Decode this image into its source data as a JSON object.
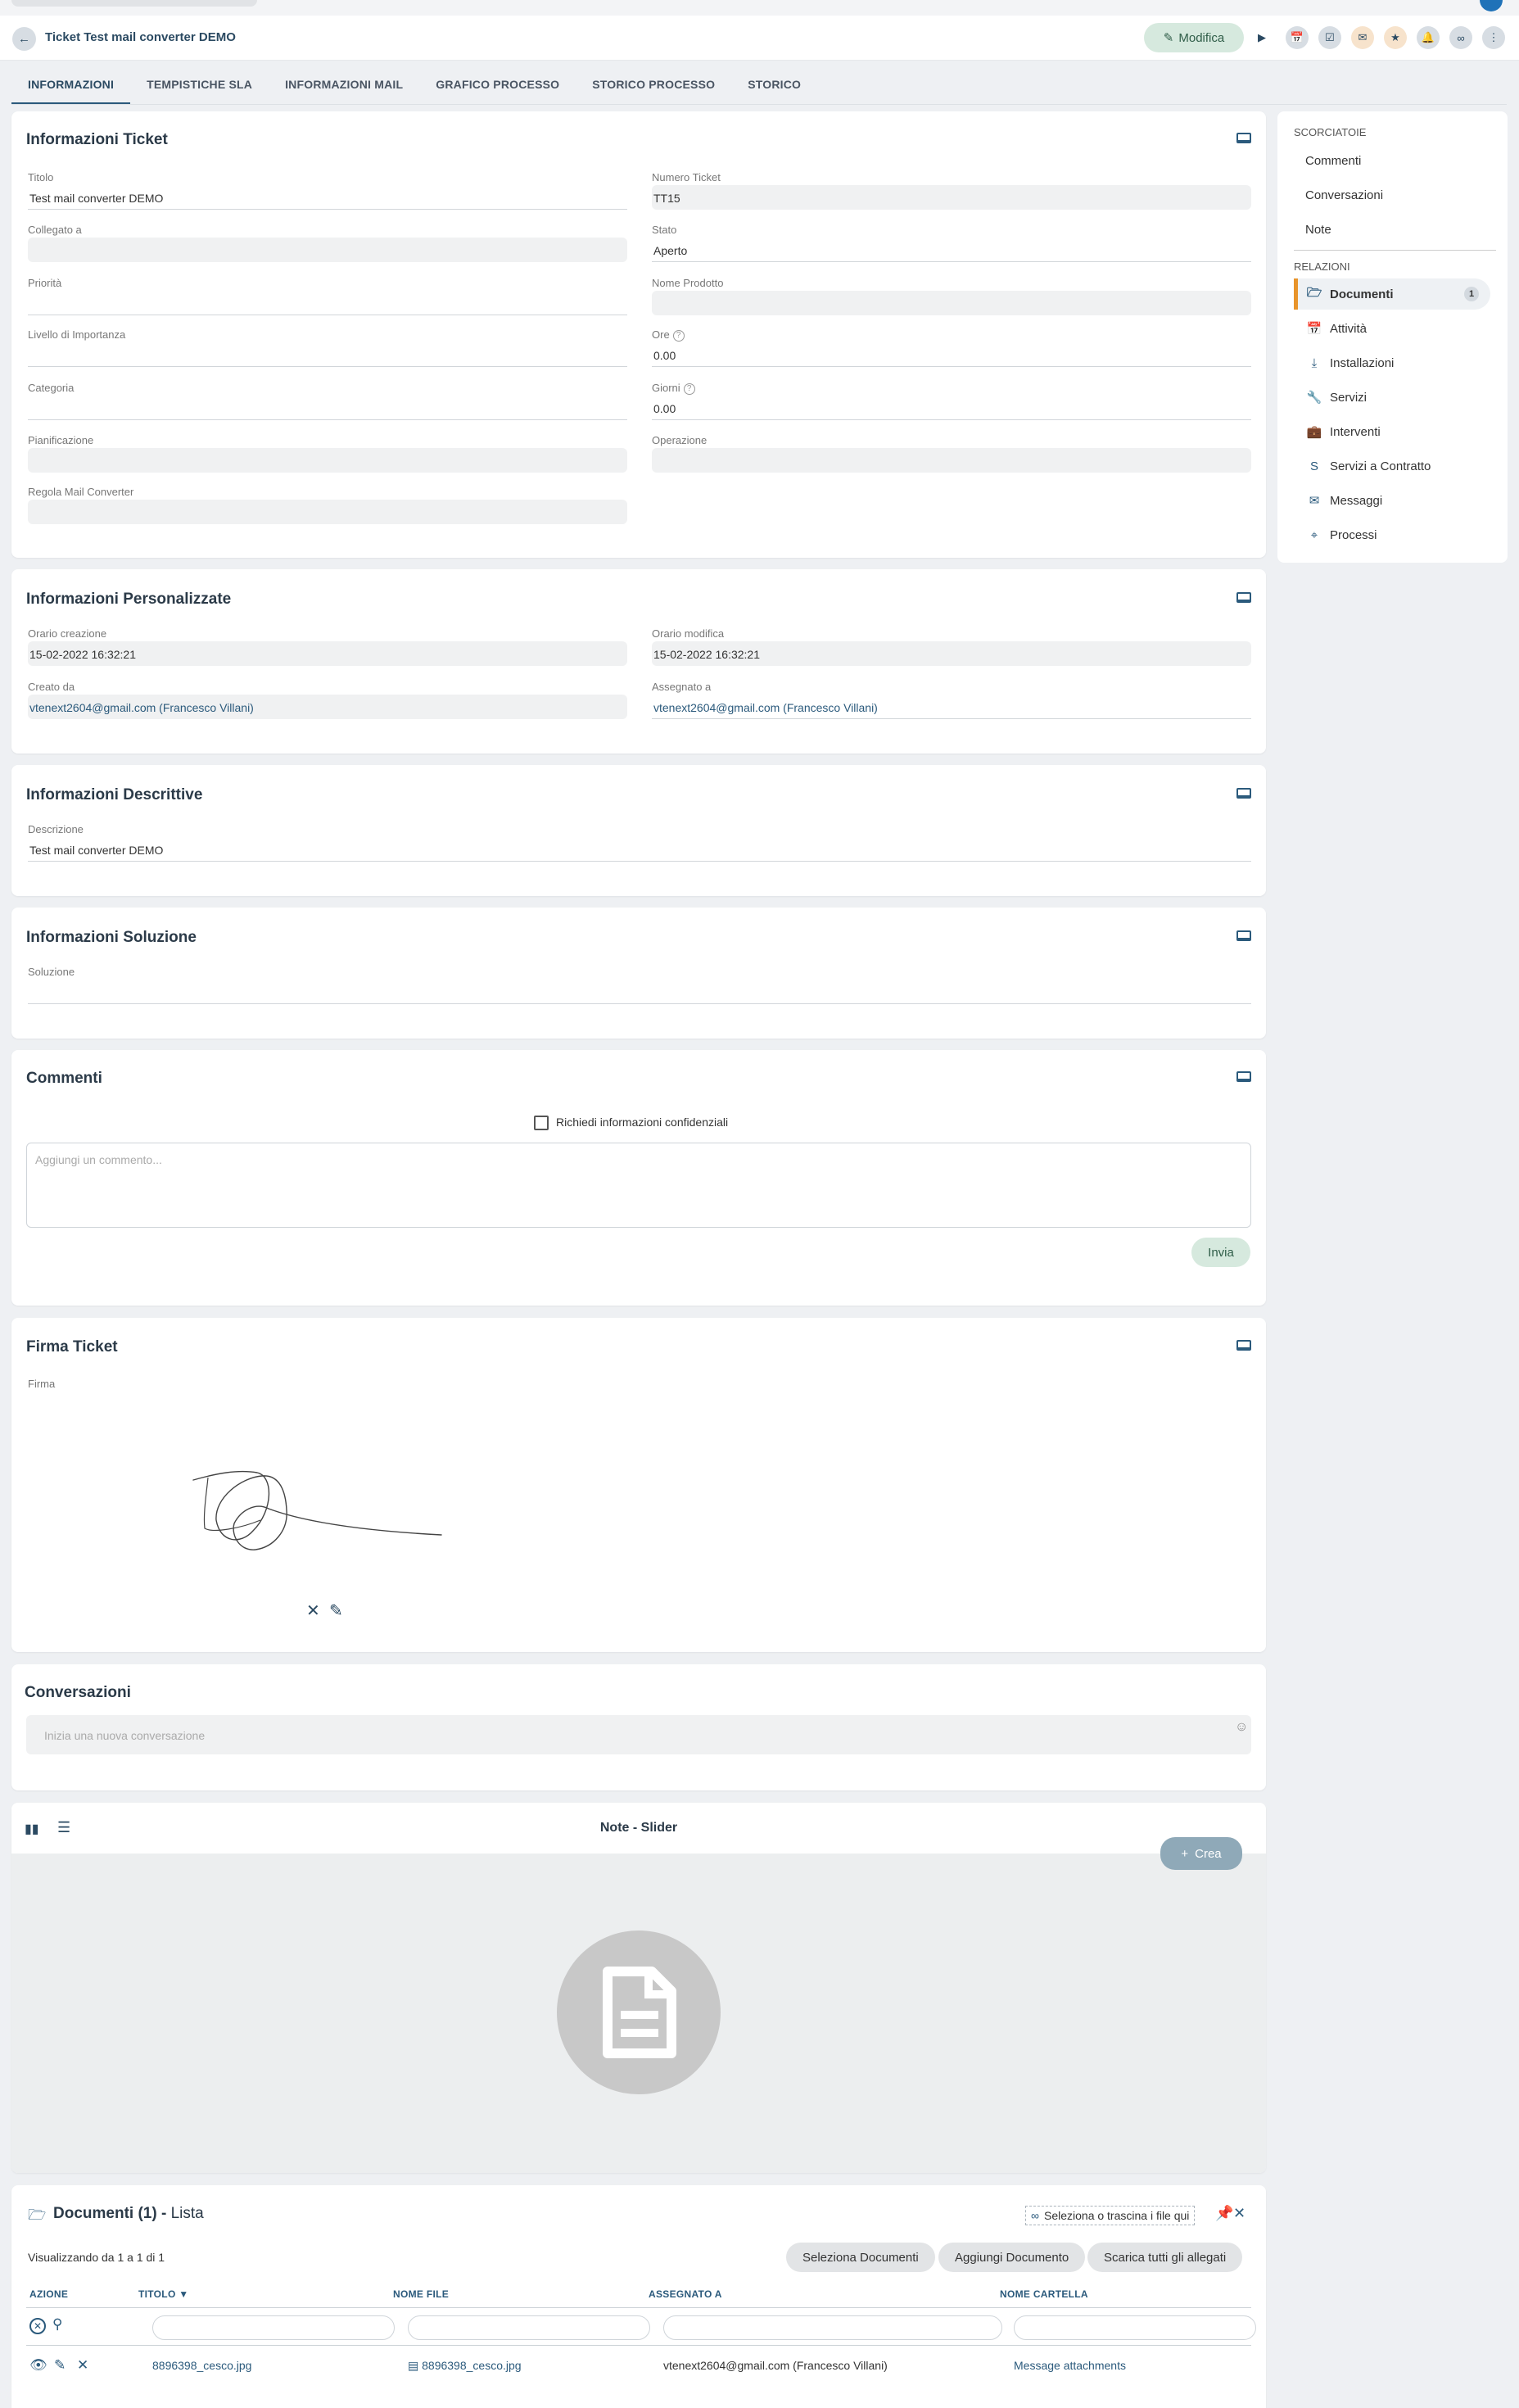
{
  "header": {
    "title": "Ticket Test mail converter DEMO",
    "edit_label": "Modifica"
  },
  "tabs": [
    {
      "label": "INFORMAZIONI"
    },
    {
      "label": "TEMPISTICHE SLA"
    },
    {
      "label": "INFORMAZIONI MAIL"
    },
    {
      "label": "GRAFICO PROCESSO"
    },
    {
      "label": "STORICO PROCESSO"
    },
    {
      "label": "STORICO"
    }
  ],
  "ticket_info": {
    "title": "Informazioni Ticket",
    "fields": {
      "titolo": {
        "label": "Titolo",
        "value": "Test mail converter DEMO"
      },
      "numero": {
        "label": "Numero Ticket",
        "value": "TT15"
      },
      "collegato": {
        "label": "Collegato a",
        "value": ""
      },
      "stato": {
        "label": "Stato",
        "value": "Aperto"
      },
      "priorita": {
        "label": "Priorità",
        "value": ""
      },
      "prodotto": {
        "label": "Nome Prodotto",
        "value": ""
      },
      "livello": {
        "label": "Livello di Importanza",
        "value": ""
      },
      "ore": {
        "label": "Ore",
        "value": "0.00"
      },
      "categoria": {
        "label": "Categoria",
        "value": ""
      },
      "giorni": {
        "label": "Giorni",
        "value": "0.00"
      },
      "pianificazione": {
        "label": "Pianificazione",
        "value": ""
      },
      "operazione": {
        "label": "Operazione",
        "value": ""
      },
      "regola": {
        "label": "Regola Mail Converter",
        "value": ""
      }
    }
  },
  "custom_info": {
    "title": "Informazioni Personalizzate",
    "fields": {
      "creazione": {
        "label": "Orario creazione",
        "value": "15-02-2022 16:32:21"
      },
      "modifica": {
        "label": "Orario modifica",
        "value": "15-02-2022 16:32:21"
      },
      "creato": {
        "label": "Creato da",
        "value": "vtenext2604@gmail.com (Francesco Villani)"
      },
      "assegnato": {
        "label": "Assegnato a",
        "value": "vtenext2604@gmail.com (Francesco Villani)"
      }
    }
  },
  "desc_info": {
    "title": "Informazioni Descrittive",
    "label": "Descrizione",
    "value": "Test mail converter DEMO"
  },
  "solution_info": {
    "title": "Informazioni Soluzione",
    "label": "Soluzione",
    "value": ""
  },
  "comments": {
    "title": "Commenti",
    "confidential_label": "Richiedi informazioni confidenziali",
    "placeholder": "Aggiungi un commento...",
    "send_label": "Invia"
  },
  "signature": {
    "title": "Firma Ticket",
    "label": "Firma"
  },
  "conversations": {
    "title": "Conversazioni",
    "placeholder": "Inizia una nuova conversazione"
  },
  "notes": {
    "title": "Note - Slider",
    "create_label": "Crea"
  },
  "documents": {
    "title": "Documenti (1)",
    "title_suffix": "Lista",
    "dropzone_label": "Seleziona o trascina i file qui",
    "showing": "Visualizzando da 1 a 1 di 1",
    "buttons": {
      "select": "Seleziona Documenti",
      "add": "Aggiungi Documento",
      "download": "Scarica tutti gli allegati"
    },
    "columns": {
      "azione": "AZIONE",
      "titolo": "TITOLO",
      "nome_file": "NOME FILE",
      "assegnato": "ASSEGNATO A",
      "cartella": "NOME CARTELLA"
    },
    "rows": [
      {
        "titolo": "8896398_cesco.jpg",
        "nome_file": "8896398_cesco.jpg",
        "assegnato": "vtenext2604@gmail.com (Francesco Villani)",
        "cartella": "Message attachments"
      }
    ]
  },
  "sidebar": {
    "shortcuts_title": "SCORCIATOIE",
    "shortcuts": [
      "Commenti",
      "Conversazioni",
      "Note"
    ],
    "relations_title": "RELAZIONI",
    "relations": [
      {
        "label": "Documenti",
        "icon": "folder-icon",
        "badge": "1"
      },
      {
        "label": "Attività",
        "icon": "calendar-icon"
      },
      {
        "label": "Installazioni",
        "icon": "download-icon"
      },
      {
        "label": "Servizi",
        "icon": "wrench-icon"
      },
      {
        "label": "Interventi",
        "icon": "toolbox-icon"
      },
      {
        "label": "Servizi a Contratto",
        "icon": "dollar-icon"
      },
      {
        "label": "Messaggi",
        "icon": "mail-icon"
      },
      {
        "label": "Processi",
        "icon": "flow-icon"
      }
    ]
  },
  "colors": {
    "accent": "#2b5a7c",
    "active_marker": "#e8942b",
    "edit_button_bg": "#d6e9de"
  }
}
